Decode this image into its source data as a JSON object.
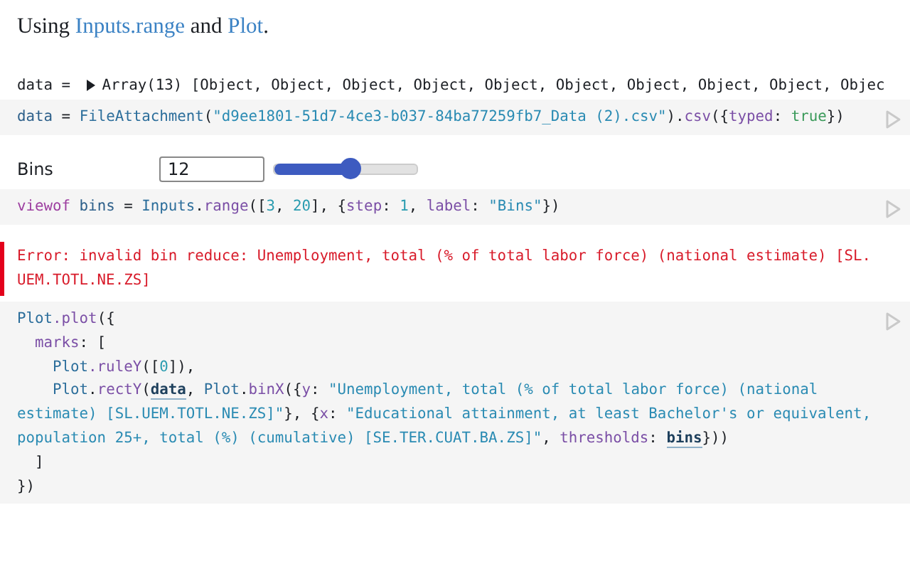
{
  "intro": [
    {
      "kind": "text",
      "text": "Using "
    },
    {
      "kind": "link",
      "text": "Inputs.range"
    },
    {
      "kind": "text",
      "text": " and "
    },
    {
      "kind": "link",
      "text": "Plot"
    },
    {
      "kind": "text",
      "text": "."
    }
  ],
  "cells": [
    {
      "kind": "inspector",
      "name": "data = ",
      "expanded": false,
      "summary": "Array(13) [Object, Object, Object, Object, Object, Object, Object, Object, Object, Objec"
    },
    {
      "kind": "code",
      "lines": [
        [
          {
            "kind": "var",
            "text": "data"
          },
          {
            "kind": "plain",
            "text": " = "
          },
          {
            "kind": "global",
            "text": "FileAttachment"
          },
          {
            "kind": "plain",
            "text": "("
          },
          {
            "kind": "string",
            "text": "\"d9ee1801-51d7-4ce3-b037-84ba77259fb7_Data (2).csv\""
          },
          {
            "kind": "plain",
            "text": ")."
          },
          {
            "kind": "member",
            "text": "csv"
          },
          {
            "kind": "plain",
            "text": "({"
          },
          {
            "kind": "member",
            "text": "typed"
          },
          {
            "kind": "plain",
            "text": ": "
          },
          {
            "kind": "bool",
            "text": "true"
          },
          {
            "kind": "plain",
            "text": "})"
          }
        ]
      ]
    },
    {
      "kind": "input",
      "label": "Bins",
      "value": "12",
      "level": 0.53
    },
    {
      "kind": "code",
      "lines": [
        [
          {
            "kind": "keyword",
            "text": "viewof"
          },
          {
            "kind": "var",
            "text": " bins"
          },
          {
            "kind": "plain",
            "text": " = "
          },
          {
            "kind": "global",
            "text": "Inputs"
          },
          {
            "kind": "plain",
            "text": "."
          },
          {
            "kind": "member",
            "text": "range"
          },
          {
            "kind": "plain",
            "text": "(["
          },
          {
            "kind": "number",
            "text": "3"
          },
          {
            "kind": "plain",
            "text": ", "
          },
          {
            "kind": "number",
            "text": "20"
          },
          {
            "kind": "plain",
            "text": "], {"
          },
          {
            "kind": "member",
            "text": "step"
          },
          {
            "kind": "plain",
            "text": ": "
          },
          {
            "kind": "number",
            "text": "1"
          },
          {
            "kind": "plain",
            "text": ", "
          },
          {
            "kind": "member",
            "text": "label"
          },
          {
            "kind": "plain",
            "text": ": "
          },
          {
            "kind": "string",
            "text": "\"Bins\""
          },
          {
            "kind": "plain",
            "text": "})"
          }
        ]
      ]
    },
    {
      "kind": "error",
      "text": "Error: invalid bin reduce: Unemployment, total (% of total labor force) (national estimate) [SL.UEM.TOTL.NE.ZS]"
    },
    {
      "kind": "code",
      "lines": [
        [
          {
            "kind": "global",
            "text": "Plot"
          },
          {
            "kind": "member",
            "text": ".plot"
          },
          {
            "kind": "plain",
            "text": "({"
          }
        ],
        [
          {
            "kind": "member",
            "text": "  marks"
          },
          {
            "kind": "plain",
            "text": ": ["
          }
        ],
        [
          {
            "kind": "global",
            "text": "    Plot"
          },
          {
            "kind": "member",
            "text": ".ruleY"
          },
          {
            "kind": "plain",
            "text": "(["
          },
          {
            "kind": "number",
            "text": "0"
          },
          {
            "kind": "plain",
            "text": "]),"
          }
        ],
        [
          {
            "kind": "global",
            "text": "    Plot"
          },
          {
            "kind": "plain",
            "text": "."
          },
          {
            "kind": "member",
            "text": "rectY"
          },
          {
            "kind": "plain",
            "text": "("
          },
          {
            "kind": "ref",
            "text": "data"
          },
          {
            "kind": "plain",
            "text": ", "
          },
          {
            "kind": "global",
            "text": "Plot"
          },
          {
            "kind": "plain",
            "text": "."
          },
          {
            "kind": "member",
            "text": "binX"
          },
          {
            "kind": "plain",
            "text": "({"
          },
          {
            "kind": "member",
            "text": "y"
          },
          {
            "kind": "plain",
            "text": ": "
          },
          {
            "kind": "string",
            "text": "\"Unemployment, total (% of total labor force) (national"
          }
        ],
        [
          {
            "kind": "string",
            "text": "estimate) [SL.UEM.TOTL.NE.ZS]\""
          },
          {
            "kind": "plain",
            "text": "}, {"
          },
          {
            "kind": "member",
            "text": "x"
          },
          {
            "kind": "plain",
            "text": ": "
          },
          {
            "kind": "string",
            "text": "\"Educational attainment, at least Bachelor's or equivalent,"
          }
        ],
        [
          {
            "kind": "string",
            "text": "population 25+, total (%) (cumulative) [SE.TER.CUAT.BA.ZS]\""
          },
          {
            "kind": "plain",
            "text": ", "
          },
          {
            "kind": "member",
            "text": "thresholds"
          },
          {
            "kind": "plain",
            "text": ": "
          },
          {
            "kind": "ref",
            "text": "bins"
          },
          {
            "kind": "plain",
            "text": "}))"
          }
        ],
        [
          {
            "kind": "plain",
            "text": "  ]"
          }
        ],
        [
          {
            "kind": "plain",
            "text": "})"
          }
        ]
      ]
    }
  ]
}
